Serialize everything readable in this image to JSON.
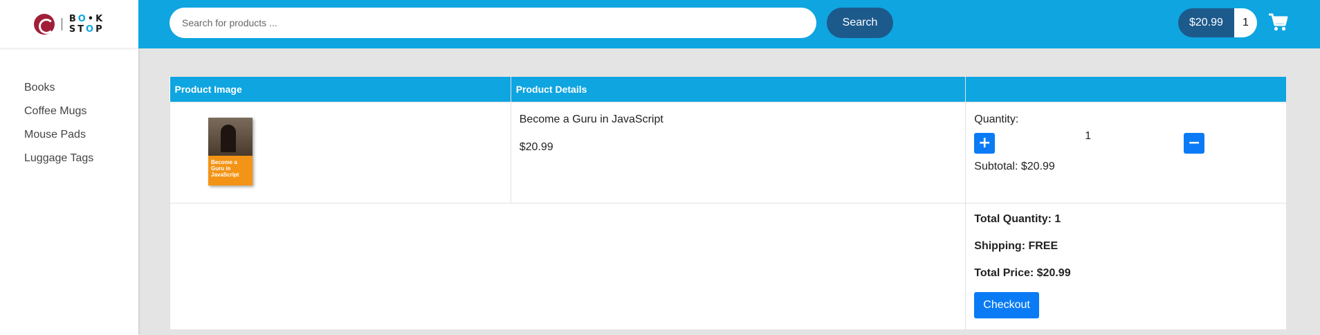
{
  "brand": {
    "logo_line1": "B",
    "logo_line1_o": "O",
    "logo_line1_rest": "•K",
    "logo_line2": "ST",
    "logo_line2_o": "O",
    "logo_line2_rest": "P"
  },
  "sidebar": {
    "items": [
      {
        "label": "Books"
      },
      {
        "label": "Coffee Mugs"
      },
      {
        "label": "Mouse Pads"
      },
      {
        "label": "Luggage Tags"
      }
    ]
  },
  "header": {
    "search_placeholder": "Search for products ...",
    "search_button": "Search",
    "cart_amount": "$20.99",
    "cart_count": "1"
  },
  "table": {
    "headers": [
      "Product Image",
      "Product Details",
      ""
    ],
    "items": [
      {
        "book_cover_text": "Become a Guru in JavaScript",
        "name": "Become a Guru in JavaScript",
        "price": "$20.99",
        "quantity_label": "Quantity:",
        "quantity": "1",
        "subtotal": "Subtotal: $20.99"
      }
    ],
    "summary": {
      "total_quantity": "Total Quantity: 1",
      "shipping": "Shipping: FREE",
      "total_price": "Total Price: $20.99",
      "checkout_label": "Checkout"
    }
  },
  "colors": {
    "accent": "#0ea5e0",
    "dark_accent": "#1d5a8c",
    "button": "#0a7bf5",
    "logo_red": "#a01e38"
  }
}
